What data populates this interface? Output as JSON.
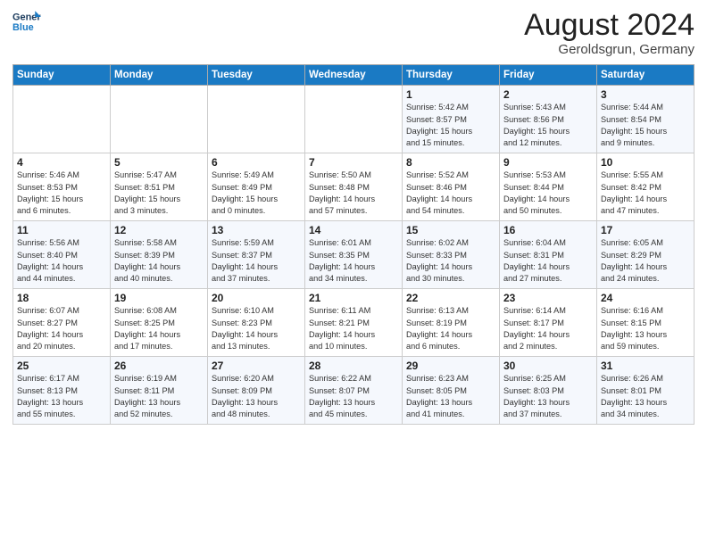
{
  "header": {
    "logo_line1": "General",
    "logo_line2": "Blue",
    "month_year": "August 2024",
    "location": "Geroldsgrun, Germany"
  },
  "weekdays": [
    "Sunday",
    "Monday",
    "Tuesday",
    "Wednesday",
    "Thursday",
    "Friday",
    "Saturday"
  ],
  "weeks": [
    [
      {
        "day": "",
        "info": ""
      },
      {
        "day": "",
        "info": ""
      },
      {
        "day": "",
        "info": ""
      },
      {
        "day": "",
        "info": ""
      },
      {
        "day": "1",
        "info": "Sunrise: 5:42 AM\nSunset: 8:57 PM\nDaylight: 15 hours\nand 15 minutes."
      },
      {
        "day": "2",
        "info": "Sunrise: 5:43 AM\nSunset: 8:56 PM\nDaylight: 15 hours\nand 12 minutes."
      },
      {
        "day": "3",
        "info": "Sunrise: 5:44 AM\nSunset: 8:54 PM\nDaylight: 15 hours\nand 9 minutes."
      }
    ],
    [
      {
        "day": "4",
        "info": "Sunrise: 5:46 AM\nSunset: 8:53 PM\nDaylight: 15 hours\nand 6 minutes."
      },
      {
        "day": "5",
        "info": "Sunrise: 5:47 AM\nSunset: 8:51 PM\nDaylight: 15 hours\nand 3 minutes."
      },
      {
        "day": "6",
        "info": "Sunrise: 5:49 AM\nSunset: 8:49 PM\nDaylight: 15 hours\nand 0 minutes."
      },
      {
        "day": "7",
        "info": "Sunrise: 5:50 AM\nSunset: 8:48 PM\nDaylight: 14 hours\nand 57 minutes."
      },
      {
        "day": "8",
        "info": "Sunrise: 5:52 AM\nSunset: 8:46 PM\nDaylight: 14 hours\nand 54 minutes."
      },
      {
        "day": "9",
        "info": "Sunrise: 5:53 AM\nSunset: 8:44 PM\nDaylight: 14 hours\nand 50 minutes."
      },
      {
        "day": "10",
        "info": "Sunrise: 5:55 AM\nSunset: 8:42 PM\nDaylight: 14 hours\nand 47 minutes."
      }
    ],
    [
      {
        "day": "11",
        "info": "Sunrise: 5:56 AM\nSunset: 8:40 PM\nDaylight: 14 hours\nand 44 minutes."
      },
      {
        "day": "12",
        "info": "Sunrise: 5:58 AM\nSunset: 8:39 PM\nDaylight: 14 hours\nand 40 minutes."
      },
      {
        "day": "13",
        "info": "Sunrise: 5:59 AM\nSunset: 8:37 PM\nDaylight: 14 hours\nand 37 minutes."
      },
      {
        "day": "14",
        "info": "Sunrise: 6:01 AM\nSunset: 8:35 PM\nDaylight: 14 hours\nand 34 minutes."
      },
      {
        "day": "15",
        "info": "Sunrise: 6:02 AM\nSunset: 8:33 PM\nDaylight: 14 hours\nand 30 minutes."
      },
      {
        "day": "16",
        "info": "Sunrise: 6:04 AM\nSunset: 8:31 PM\nDaylight: 14 hours\nand 27 minutes."
      },
      {
        "day": "17",
        "info": "Sunrise: 6:05 AM\nSunset: 8:29 PM\nDaylight: 14 hours\nand 24 minutes."
      }
    ],
    [
      {
        "day": "18",
        "info": "Sunrise: 6:07 AM\nSunset: 8:27 PM\nDaylight: 14 hours\nand 20 minutes."
      },
      {
        "day": "19",
        "info": "Sunrise: 6:08 AM\nSunset: 8:25 PM\nDaylight: 14 hours\nand 17 minutes."
      },
      {
        "day": "20",
        "info": "Sunrise: 6:10 AM\nSunset: 8:23 PM\nDaylight: 14 hours\nand 13 minutes."
      },
      {
        "day": "21",
        "info": "Sunrise: 6:11 AM\nSunset: 8:21 PM\nDaylight: 14 hours\nand 10 minutes."
      },
      {
        "day": "22",
        "info": "Sunrise: 6:13 AM\nSunset: 8:19 PM\nDaylight: 14 hours\nand 6 minutes."
      },
      {
        "day": "23",
        "info": "Sunrise: 6:14 AM\nSunset: 8:17 PM\nDaylight: 14 hours\nand 2 minutes."
      },
      {
        "day": "24",
        "info": "Sunrise: 6:16 AM\nSunset: 8:15 PM\nDaylight: 13 hours\nand 59 minutes."
      }
    ],
    [
      {
        "day": "25",
        "info": "Sunrise: 6:17 AM\nSunset: 8:13 PM\nDaylight: 13 hours\nand 55 minutes."
      },
      {
        "day": "26",
        "info": "Sunrise: 6:19 AM\nSunset: 8:11 PM\nDaylight: 13 hours\nand 52 minutes."
      },
      {
        "day": "27",
        "info": "Sunrise: 6:20 AM\nSunset: 8:09 PM\nDaylight: 13 hours\nand 48 minutes."
      },
      {
        "day": "28",
        "info": "Sunrise: 6:22 AM\nSunset: 8:07 PM\nDaylight: 13 hours\nand 45 minutes."
      },
      {
        "day": "29",
        "info": "Sunrise: 6:23 AM\nSunset: 8:05 PM\nDaylight: 13 hours\nand 41 minutes."
      },
      {
        "day": "30",
        "info": "Sunrise: 6:25 AM\nSunset: 8:03 PM\nDaylight: 13 hours\nand 37 minutes."
      },
      {
        "day": "31",
        "info": "Sunrise: 6:26 AM\nSunset: 8:01 PM\nDaylight: 13 hours\nand 34 minutes."
      }
    ]
  ]
}
